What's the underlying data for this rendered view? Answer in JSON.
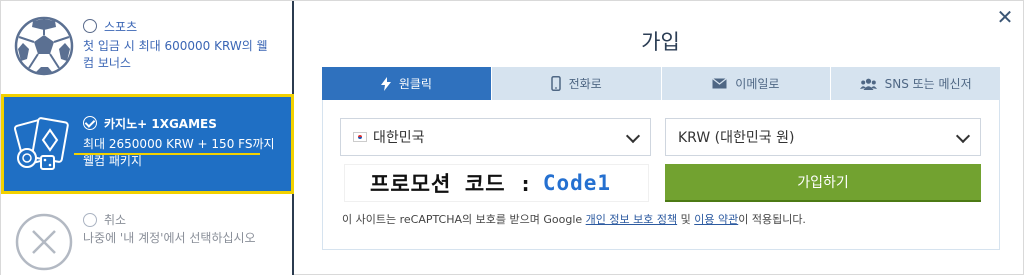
{
  "bonuses": [
    {
      "title": "스포츠",
      "desc": "첫 입금 시 최대 600000 KRW의 웰컴 보너스",
      "icon": "soccer-ball-icon"
    },
    {
      "title": "카지노+ 1XGAMES",
      "desc": "최대 2650000 KRW + 150 FS까지 웰컴 패키지",
      "icon": "casino-chips-icon",
      "selected": true
    },
    {
      "title": "취소",
      "desc": "나중에 '내 계정'에서 선택하십시오",
      "icon": "cancel-circle-icon"
    }
  ],
  "dialog": {
    "title": "가입",
    "close_icon": "close-icon"
  },
  "tabs": [
    {
      "label": "원클릭",
      "icon": "lightning-icon",
      "active": true
    },
    {
      "label": "전화로",
      "icon": "phone-icon"
    },
    {
      "label": "이메일로",
      "icon": "envelope-icon"
    },
    {
      "label": "SNS 또는 메신저",
      "icon": "users-icon"
    }
  ],
  "form": {
    "country": "대한민국",
    "currency": "KRW (대한민국 원)",
    "promo_label": "프로모션 코드 :",
    "promo_code": "Code1",
    "submit": "가입하기",
    "notice_prefix": "이 사이트는 reCAPTCHA의 보호를 받으며 Google ",
    "privacy_link": "개인 정보 보호 정책",
    "notice_mid": " 및 ",
    "terms_link": "이용 약관",
    "notice_suffix": "이 적용됩니다."
  },
  "colors": {
    "accent": "#2f71be",
    "highlight_border": "#f2d100",
    "submit_green": "#72a230",
    "promo_code_blue": "#2570d0"
  }
}
